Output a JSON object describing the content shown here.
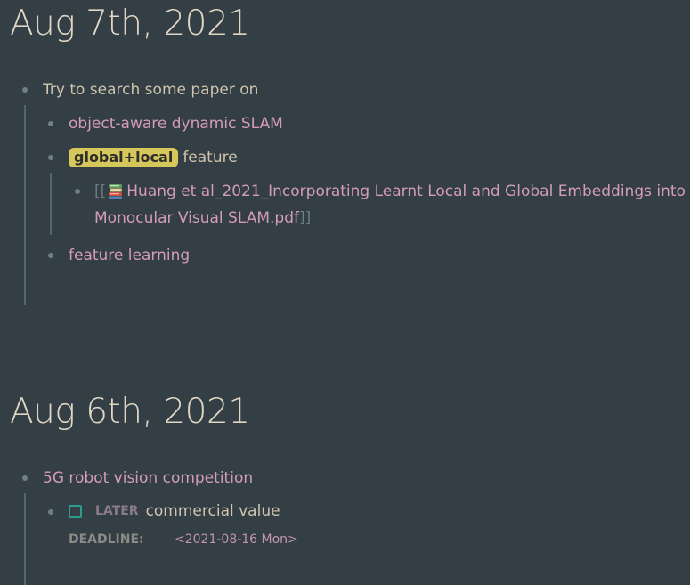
{
  "journals": [
    {
      "title": "Aug 7th, 2021",
      "blocks": {
        "root": "Try to search some paper on",
        "child1": "object-aware dynamic SLAM",
        "child2_tag": "global+local",
        "child2_text": "feature",
        "pdf_open": "[[",
        "pdf_line1": "Huang et al_2021_Incorporating Learnt Local and Global Embeddings into",
        "pdf_line2": "Monocular Visual SLAM.pdf",
        "pdf_close": "]]",
        "child3": "feature learning"
      }
    },
    {
      "title": "Aug 6th, 2021",
      "blocks": {
        "root": "5G robot vision competition",
        "task_marker": "LATER",
        "task_text": "commercial value",
        "deadline_label": "DEADLINE:",
        "deadline_value": "<2021-08-16 Mon>"
      }
    }
  ],
  "icons": {
    "bullet": "bullet-dot-icon",
    "book": "books-icon",
    "checkbox": "checkbox-icon"
  },
  "colors": {
    "background": "#333e45",
    "title": "#dfd6c4",
    "text": "#cfc4ad",
    "link": "#d49bbd",
    "tag_bg": "#d6c75a",
    "checkbox": "#2e9b8f"
  }
}
